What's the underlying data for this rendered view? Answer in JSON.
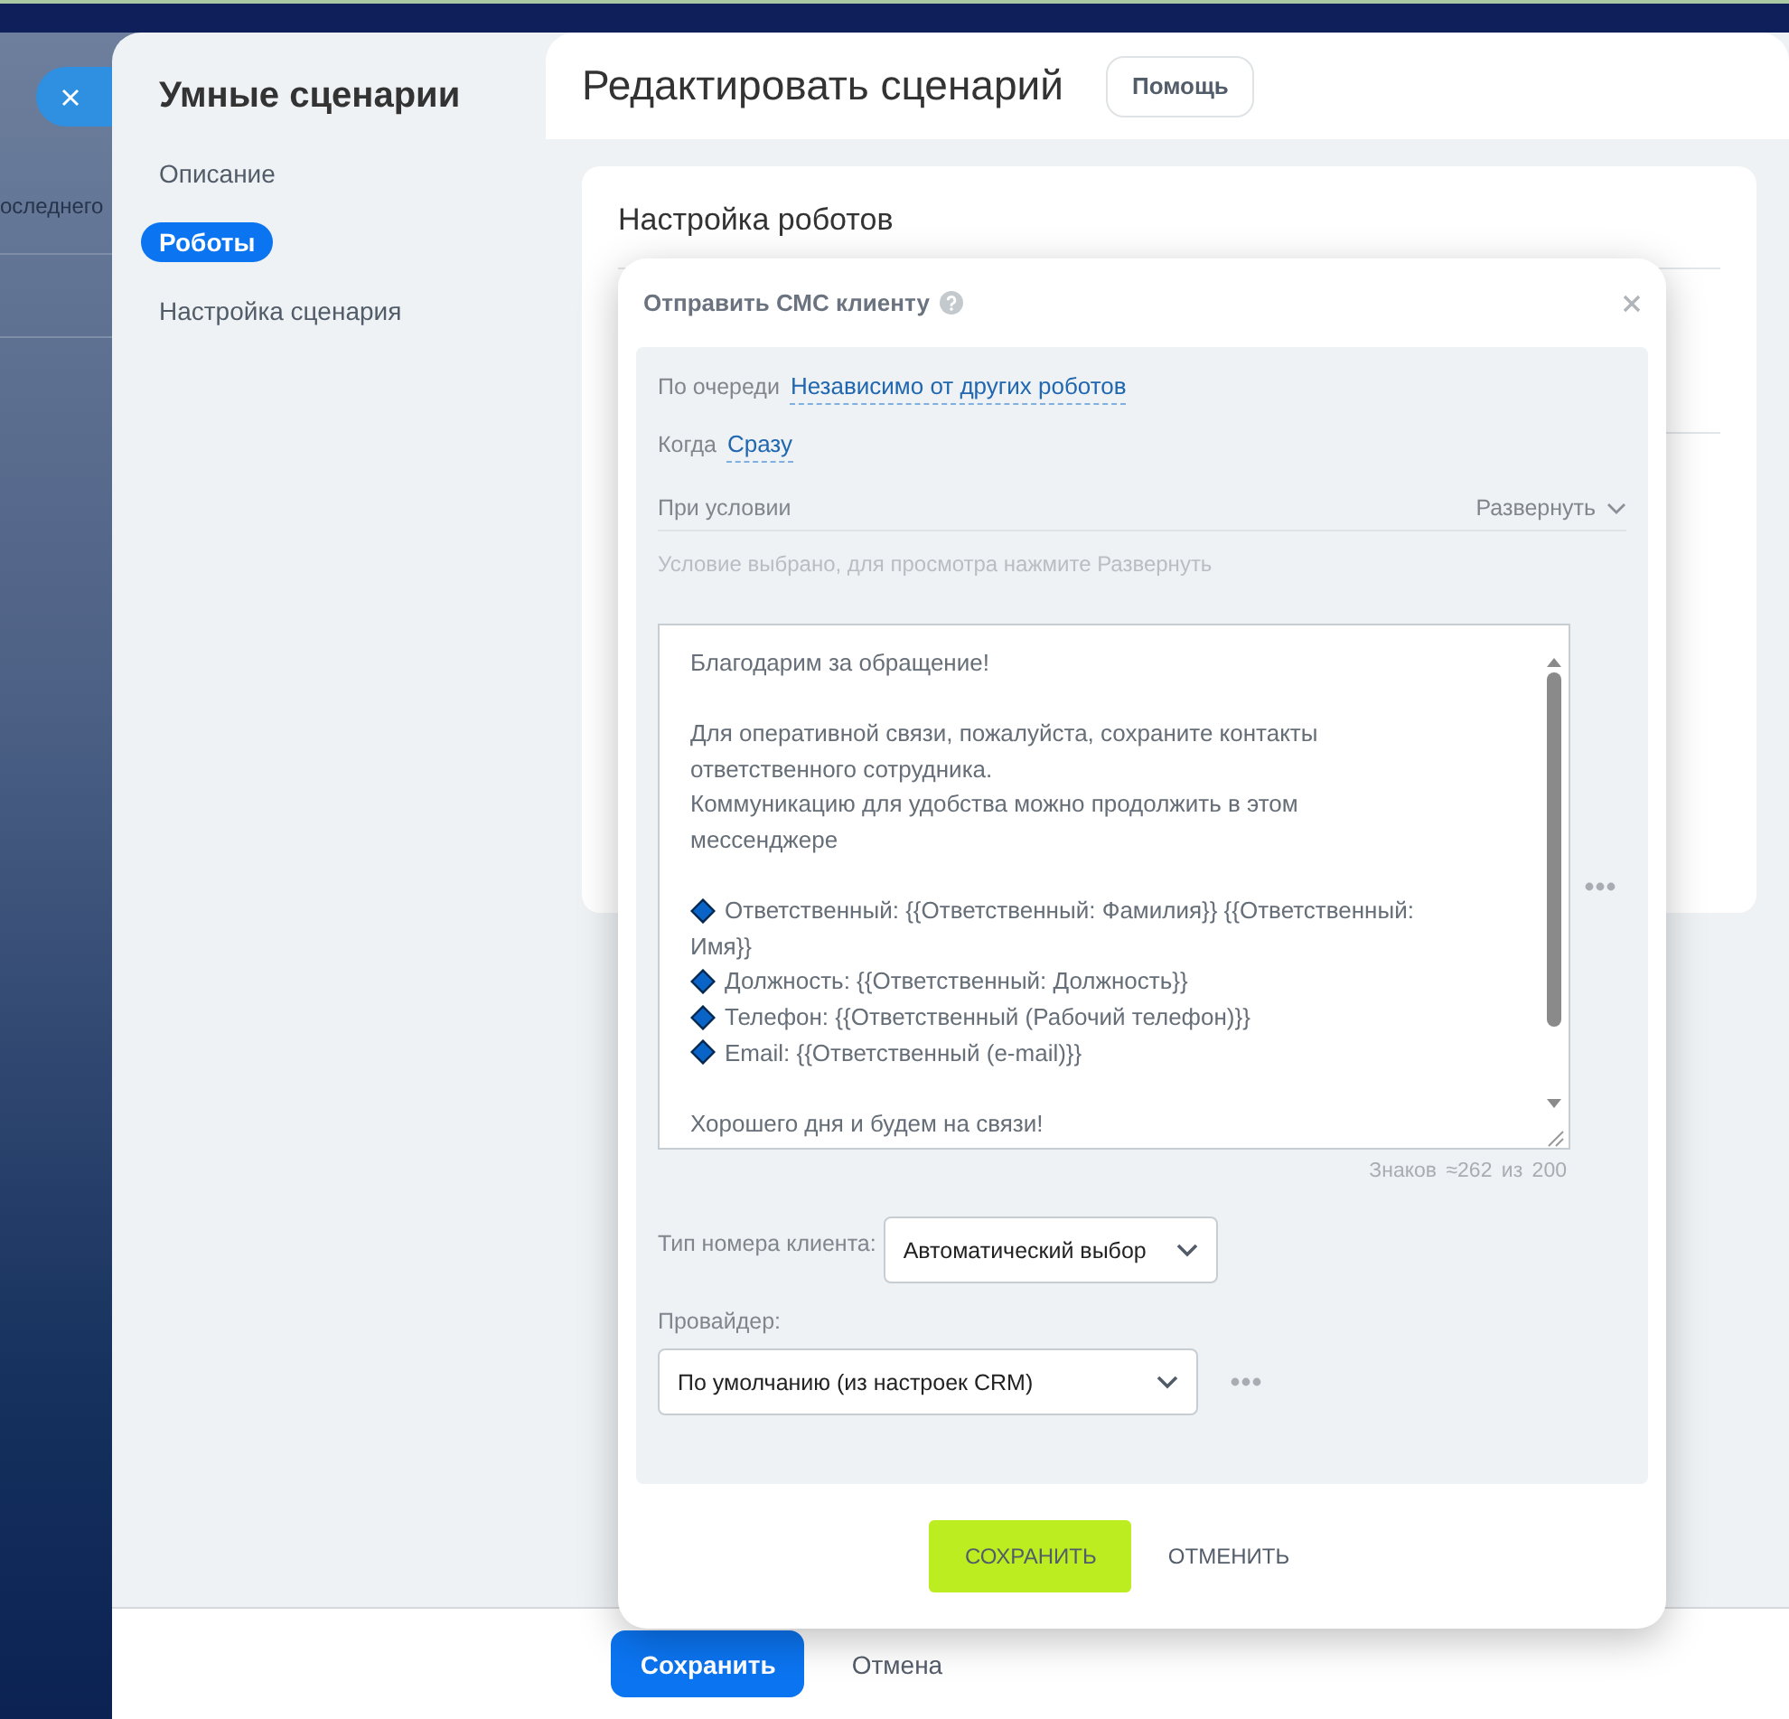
{
  "background_page": {
    "text": "оследнего"
  },
  "sidebar": {
    "title": "Умные сценарии",
    "items": [
      {
        "label": "Описание",
        "selected": false
      },
      {
        "label": "Роботы",
        "selected": true
      },
      {
        "label": "Настройка сценария",
        "selected": false
      }
    ]
  },
  "header": {
    "title": "Редактировать сценарий",
    "help_button": "Помощь"
  },
  "card": {
    "title": "Настройка роботов"
  },
  "dialog": {
    "title": "Отправить СМС клиенту",
    "order": {
      "label": "По очереди",
      "value": "Независимо от других роботов"
    },
    "when": {
      "label": "Когда",
      "value": "Сразу"
    },
    "condition": {
      "label": "При условии",
      "toggle": "Развернуть",
      "hint": "Условие выбрано, для просмотра нажмите Развернуть"
    },
    "message": {
      "lines": [
        {
          "kind": "text",
          "text": "Благодарим за обращение!"
        },
        {
          "kind": "blank"
        },
        {
          "kind": "text",
          "text": "Для оперативной связи, пожалуйста, сохраните контакты"
        },
        {
          "kind": "text",
          "text": "ответственного сотрудника."
        },
        {
          "kind": "text",
          "text": "Коммуникацию для удобства можно продолжить в этом"
        },
        {
          "kind": "text",
          "text": "мессенджере"
        },
        {
          "kind": "blank"
        },
        {
          "kind": "bullet",
          "text": "Ответственный: {{Ответственный: Фамилия}} {{Ответственный:"
        },
        {
          "kind": "text",
          "text": "Имя}}"
        },
        {
          "kind": "bullet",
          "text": "Должность: {{Ответственный: Должность}}"
        },
        {
          "kind": "bullet",
          "text": "Телефон: {{Ответственный (Рабочий телефон)}}"
        },
        {
          "kind": "bullet",
          "text": "Email: {{Ответственный (e-mail)}}"
        },
        {
          "kind": "blank"
        },
        {
          "kind": "text",
          "text": "Хорошего дня и будем на связи!"
        }
      ]
    },
    "counter": "Знаков ≈262 из 200",
    "number_type": {
      "label": "Тип номера клиента:",
      "value": "Автоматический выбор"
    },
    "provider": {
      "label": "Провайдер:",
      "value": "По умолчанию (из настроек CRM)"
    },
    "buttons": [
      {
        "label": "СОХРАНИТЬ",
        "kind": "primary"
      },
      {
        "label": "ОТМЕНИТЬ",
        "kind": "link"
      }
    ]
  },
  "footer": {
    "buttons": [
      {
        "label": "Сохранить",
        "kind": "primary"
      },
      {
        "label": "Отмена",
        "kind": "secondary"
      }
    ]
  }
}
